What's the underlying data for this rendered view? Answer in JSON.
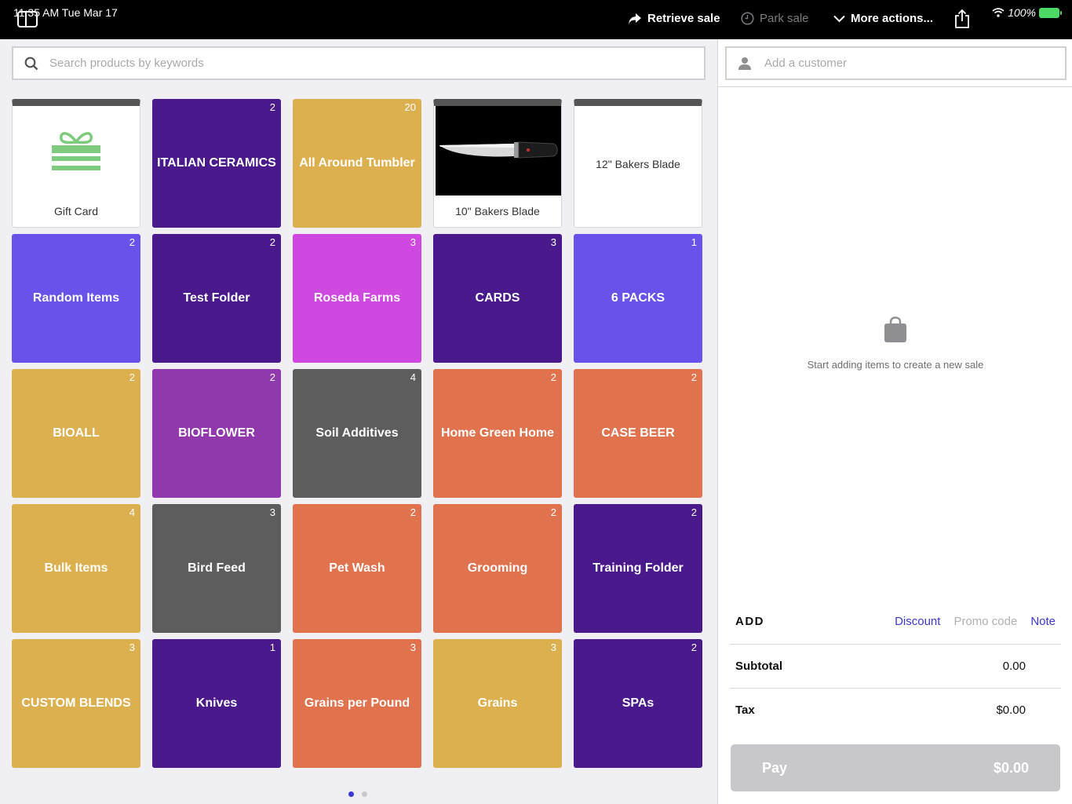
{
  "status_bar": {
    "time_date": "11:35 AM   Tue Mar 17",
    "battery": "100%"
  },
  "toolbar": {
    "retrieve_sale": "Retrieve sale",
    "park_sale": "Park sale",
    "more_actions": "More actions..."
  },
  "search": {
    "placeholder": "Search products by keywords"
  },
  "tiles": [
    {
      "label": "Gift Card",
      "kind": "gift"
    },
    {
      "label": "ITALIAN CERAMICS",
      "count": "2",
      "color": "#4a1a8c"
    },
    {
      "label": "All Around Tumbler",
      "count": "20",
      "color": "#ddb04f"
    },
    {
      "label": "10\" Bakers Blade",
      "kind": "knife"
    },
    {
      "label": "12\" Bakers Blade",
      "kind": "product"
    },
    {
      "label": "Random Items",
      "count": "2",
      "color": "#6753ea"
    },
    {
      "label": "Test Folder",
      "count": "2",
      "color": "#4a1a8c"
    },
    {
      "label": "Roseda Farms",
      "count": "3",
      "color": "#cf48e0"
    },
    {
      "label": "CARDS",
      "count": "3",
      "color": "#4a1a8c"
    },
    {
      "label": "6 PACKS",
      "count": "1",
      "color": "#6753ea"
    },
    {
      "label": "BIOALL",
      "count": "2",
      "color": "#ddb04f"
    },
    {
      "label": "BIOFLOWER",
      "count": "2",
      "color": "#9138ad"
    },
    {
      "label": "Soil Additives",
      "count": "4",
      "color": "#5d5d5d"
    },
    {
      "label": "Home Green Home",
      "count": "2",
      "color": "#e0724d"
    },
    {
      "label": "CASE BEER",
      "count": "2",
      "color": "#e0724d"
    },
    {
      "label": "Bulk Items",
      "count": "4",
      "color": "#ddb04f"
    },
    {
      "label": "Bird Feed",
      "count": "3",
      "color": "#5d5d5d"
    },
    {
      "label": "Pet Wash",
      "count": "2",
      "color": "#e0724d"
    },
    {
      "label": "Grooming",
      "count": "2",
      "color": "#e0724d"
    },
    {
      "label": "Training Folder",
      "count": "2",
      "color": "#4a1a8c"
    },
    {
      "label": "CUSTOM BLENDS",
      "count": "3",
      "color": "#ddb04f"
    },
    {
      "label": "Knives",
      "count": "1",
      "color": "#4a1a8c"
    },
    {
      "label": "Grains per Pound",
      "count": "3",
      "color": "#e0724d"
    },
    {
      "label": "Grains",
      "count": "3",
      "color": "#ddb04f"
    },
    {
      "label": "SPAs",
      "count": "2",
      "color": "#4a1a8c"
    }
  ],
  "pager": {
    "pages": 2,
    "current": 1
  },
  "customer": {
    "placeholder": "Add a customer"
  },
  "sale": {
    "empty_message": "Start adding items to create a new sale",
    "add_title": "ADD",
    "discount": "Discount",
    "promo_code": "Promo code",
    "note": "Note",
    "subtotal_label": "Subtotal",
    "subtotal_value": "0.00",
    "tax_label": "Tax",
    "tax_value": "$0.00",
    "pay_label": "Pay",
    "pay_amount": "$0.00"
  },
  "colors": {
    "accent": "#3b38d6",
    "topbar": "#000000"
  }
}
